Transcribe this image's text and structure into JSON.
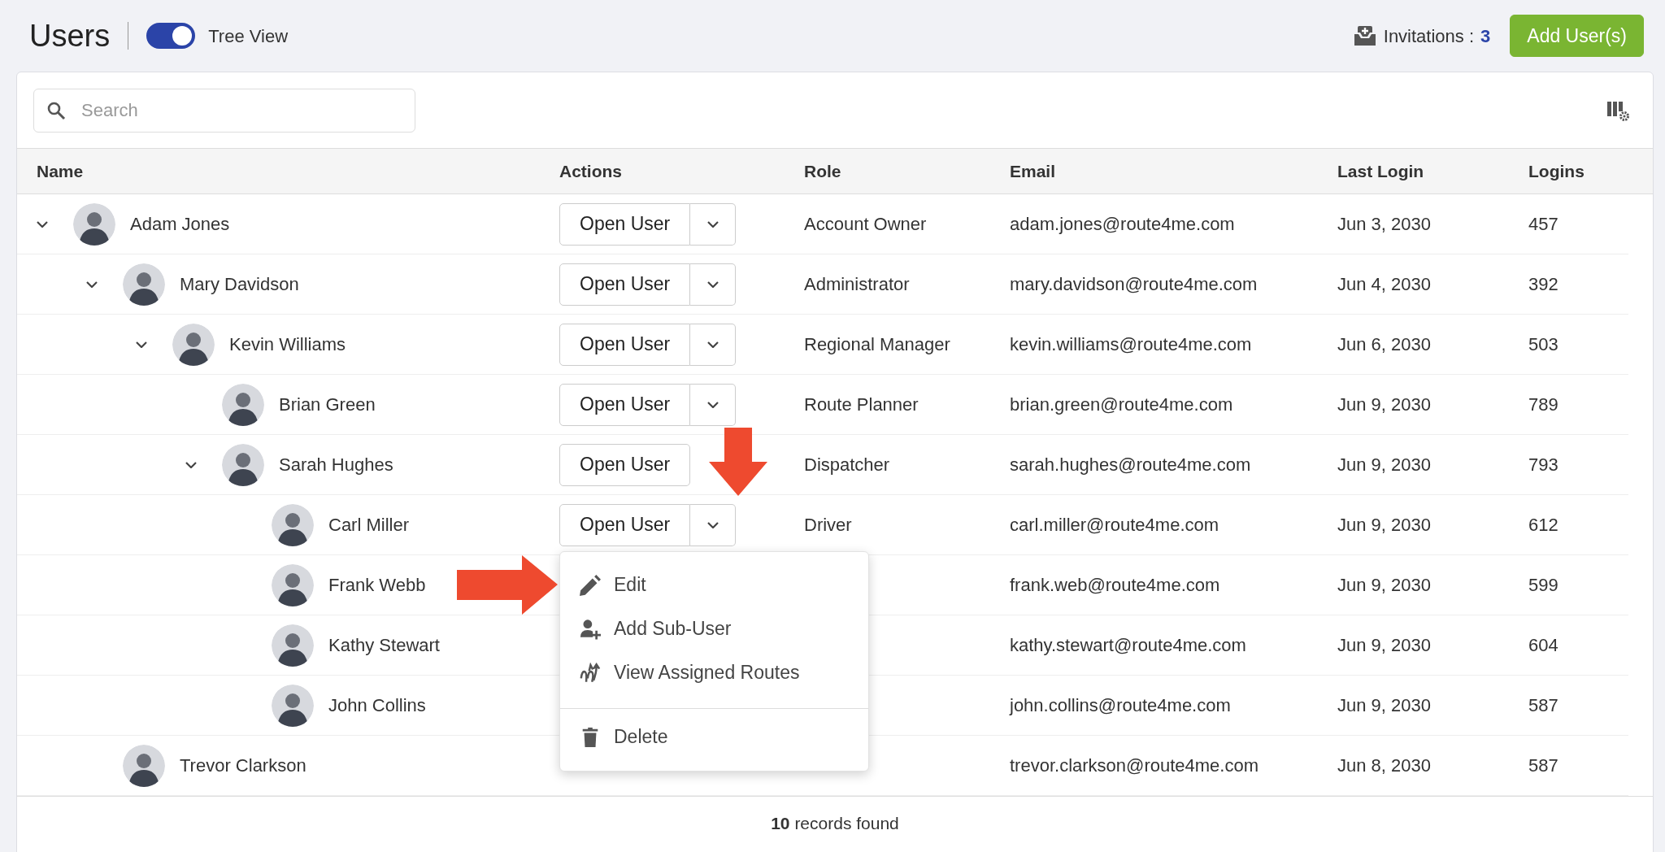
{
  "page": {
    "title": "Users",
    "tree_view": {
      "label": "Tree View",
      "on": true
    },
    "invitations": {
      "label": "Invitations :",
      "count": "3"
    },
    "add_button": "Add User(s)"
  },
  "search": {
    "placeholder": "Search"
  },
  "table": {
    "columns": [
      "Name",
      "Actions",
      "Role",
      "Email",
      "Last Login",
      "Logins"
    ],
    "rows": [
      {
        "name": "Adam Jones",
        "expanded": true,
        "action": "Open User",
        "role": "Account Owner",
        "email": "adam.jones@route4me.com",
        "last_login": "Jun 3, 2030",
        "logins": "457",
        "children": [
          {
            "name": "Mary Davidson",
            "expanded": true,
            "action": "Open User",
            "role": "Administrator",
            "email": "mary.davidson@route4me.com",
            "last_login": "Jun 4, 2030",
            "logins": "392",
            "children": [
              {
                "name": "Kevin Williams",
                "expanded": true,
                "action": "Open User",
                "role": "Regional Manager",
                "email": "kevin.williams@route4me.com",
                "last_login": "Jun 6, 2030",
                "logins": "503",
                "children": [
                  {
                    "name": "Brian Green",
                    "action": "Open User",
                    "role": "Route Planner",
                    "email": "brian.green@route4me.com",
                    "last_login": "Jun 9, 2030",
                    "logins": "789"
                  },
                  {
                    "name": "Sarah Hughes",
                    "expanded": true,
                    "action": "Open User",
                    "dropdown": false,
                    "role": "Dispatcher",
                    "email": "sarah.hughes@route4me.com",
                    "last_login": "Jun 9, 2030",
                    "logins": "793",
                    "children": [
                      {
                        "name": "Carl Miller",
                        "action": "Open User",
                        "role": "Driver",
                        "email": "carl.miller@route4me.com",
                        "last_login": "Jun 9, 2030",
                        "logins": "612",
                        "menu": {
                          "items": [
                            {
                              "kind": "edit",
                              "label": "Edit"
                            },
                            {
                              "kind": "add-user",
                              "label": "Add Sub-User"
                            },
                            {
                              "kind": "routes",
                              "label": "View Assigned Routes"
                            },
                            {
                              "kind": "delete",
                              "label": "Delete"
                            }
                          ]
                        }
                      },
                      {
                        "name": "Frank Webb",
                        "email": "frank.web@route4me.com",
                        "last_login": "Jun 9, 2030",
                        "logins": "599"
                      },
                      {
                        "name": "Kathy Stewart",
                        "email": "kathy.stewart@route4me.com",
                        "last_login": "Jun 9, 2030",
                        "logins": "604"
                      },
                      {
                        "name": "John Collins",
                        "email": "john.collins@route4me.com",
                        "last_login": "Jun 9, 2030",
                        "logins": "587"
                      }
                    ]
                  }
                ]
              }
            ]
          },
          {
            "name": "Trevor Clarkson",
            "email": "trevor.clarkson@route4me.com",
            "last_login": "Jun 8, 2030",
            "logins": "587"
          }
        ]
      }
    ]
  },
  "footer": "**10** records found"
}
